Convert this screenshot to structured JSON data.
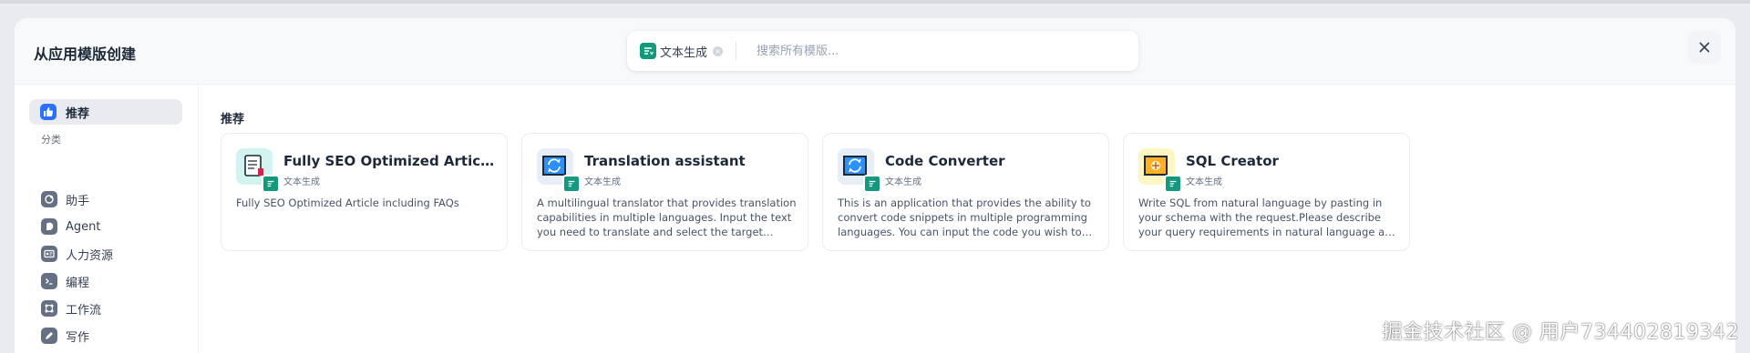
{
  "modal": {
    "title": "从应用模版创建",
    "close_icon": "close-icon"
  },
  "search": {
    "filter_chip_label": "文本生成",
    "placeholder": "搜索所有模版..."
  },
  "sidebar": {
    "recommended": {
      "label": "推荐",
      "icon": "thumbs-up-icon",
      "color": "#2970ff"
    },
    "category_label": "分类",
    "items": [
      {
        "label": "助手",
        "icon": "assistant-icon"
      },
      {
        "label": "Agent",
        "icon": "agent-icon"
      },
      {
        "label": "人力资源",
        "icon": "id-card-icon"
      },
      {
        "label": "编程",
        "icon": "terminal-icon"
      },
      {
        "label": "工作流",
        "icon": "workflow-icon"
      },
      {
        "label": "写作",
        "icon": "pen-icon"
      }
    ]
  },
  "main": {
    "section_title": "推荐",
    "cards": [
      {
        "title": "Fully SEO Optimized Article including FAQs",
        "type": "文本生成",
        "description": "Fully SEO Optimized Article including FAQs",
        "icon": "document-icon",
        "icon_bg": "#d1f4f1"
      },
      {
        "title": "Translation assistant",
        "type": "文本生成",
        "description": "A multilingual translator that provides translation capabilities in multiple languages. Input the text you need to translate and select the target language.",
        "icon": "translate-icon",
        "icon_bg": "#e8eef7"
      },
      {
        "title": "Code Converter",
        "type": "文本生成",
        "description": "This is an application that provides the ability to convert code snippets in multiple programming languages. You can input the code you wish to convert.",
        "icon": "convert-icon",
        "icon_bg": "#e8eef7"
      },
      {
        "title": "SQL Creator",
        "type": "文本生成",
        "description": "Write SQL from natural language by pasting in your schema with the request.Please describe your query requirements in natural language and select the target database type.",
        "icon": "database-icon",
        "icon_bg": "#fef7c3"
      }
    ]
  },
  "watermark": "掘金技术社区 @ 用户734402819342",
  "colors": {
    "accent": "#12997e",
    "primary": "#2970ff"
  }
}
